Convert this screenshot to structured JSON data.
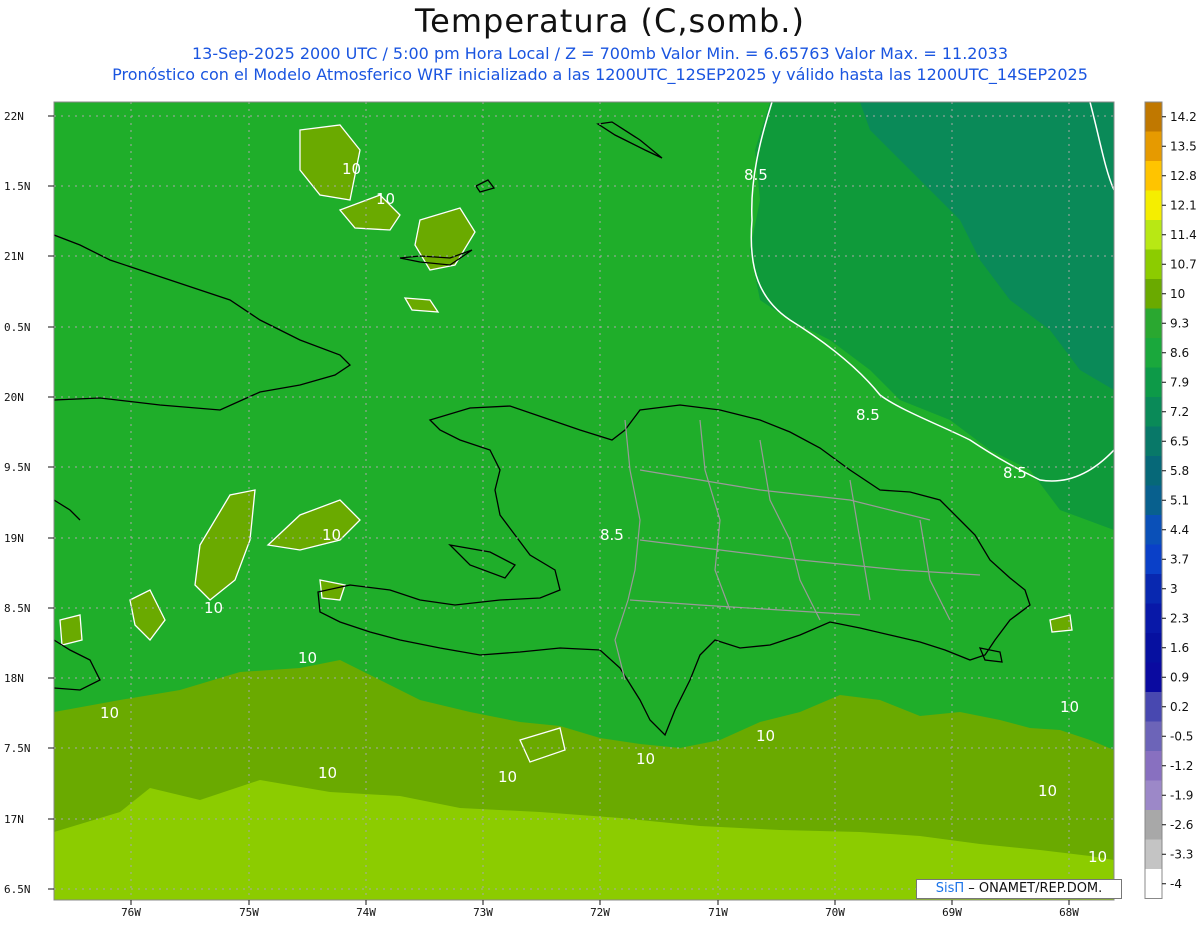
{
  "header": {
    "title": "Temperatura (C,somb.)",
    "line1": "13-Sep-2025  2000 UTC / 5:00 pm Hora Local / Z = 700mb    Valor Min. = 6.65763  Valor Max. = 11.2033",
    "line2": "Pronóstico con el Modelo Atmosferico WRF inicializado a las 1200UTC_12SEP2025 y válido hasta las  1200UTC_14SEP2025"
  },
  "axes": {
    "lat_labels": [
      "22N",
      "1.5N",
      "21N",
      "0.5N",
      "20N",
      "9.5N",
      "19N",
      "8.5N",
      "18N",
      "7.5N",
      "17N",
      "6.5N"
    ],
    "lon_labels": [
      "76W",
      "75W",
      "74W",
      "73W",
      "72W",
      "71W",
      "70W",
      "69W",
      "68W"
    ]
  },
  "colorbar": {
    "labels": [
      "14.2",
      "13.5",
      "12.8",
      "12.1",
      "11.4",
      "10.7",
      "10",
      "9.3",
      "8.6",
      "7.9",
      "7.2",
      "6.5",
      "5.8",
      "5.1",
      "4.4",
      "3.7",
      "3",
      "2.3",
      "1.6",
      "0.9",
      "0.2",
      "-0.5",
      "-1.2",
      "-1.9",
      "-2.6",
      "-3.3",
      "-4"
    ],
    "colors": [
      "#c07800",
      "#e69a00",
      "#ffc400",
      "#f5ee00",
      "#b8e814",
      "#8ccc00",
      "#6aaa00",
      "#2aa830",
      "#1aa83c",
      "#0d9a48",
      "#0a8a58",
      "#087868",
      "#066878",
      "#08608e",
      "#0a50b8",
      "#0a40c8",
      "#0828b0",
      "#0818a8",
      "#0610a0",
      "#0a0aa0",
      "#4848b0",
      "#6c64b8",
      "#8870c0",
      "#9c88c8",
      "#a8a8a8",
      "#c4c4c4",
      "#ffffff"
    ]
  },
  "contour_labels": [
    "10",
    "10",
    "10",
    "10",
    "10",
    "10",
    "10",
    "10",
    "10",
    "10",
    "10",
    "10",
    "10",
    "8.5",
    "8.5",
    "8.5",
    "8.5"
  ],
  "credit": {
    "brand": "SisΠ",
    "text": " ONAMET/REP.DOM."
  }
}
